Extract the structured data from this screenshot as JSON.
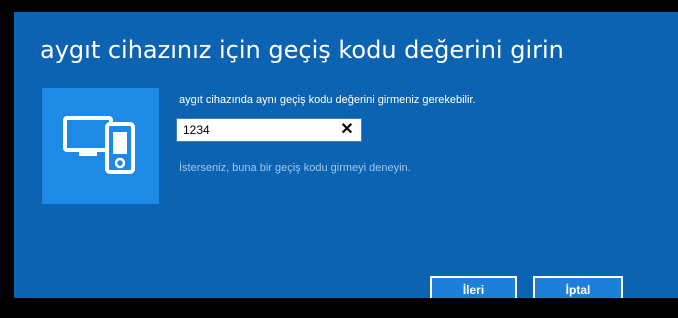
{
  "dialog": {
    "title": "aygıt cihazınız için geçiş kodu değerini girin",
    "device_icon": "pc-and-phone-icon",
    "info": "aygıt cihazında aynı geçiş kodu değerini girmeniz gerekebilir.",
    "code_value": "1234",
    "clear_glyph": "✕",
    "hint": "İsterseniz, buna bir geçiş kodu girmeyi deneyin."
  },
  "buttons": {
    "next_label": "İleri",
    "cancel_label": "İptal"
  },
  "colors": {
    "dialog_background": "#0c63b1",
    "tile_background": "#1d8ae6",
    "button_background": "#1d7fd8",
    "hint_text": "#9ec8ee"
  }
}
